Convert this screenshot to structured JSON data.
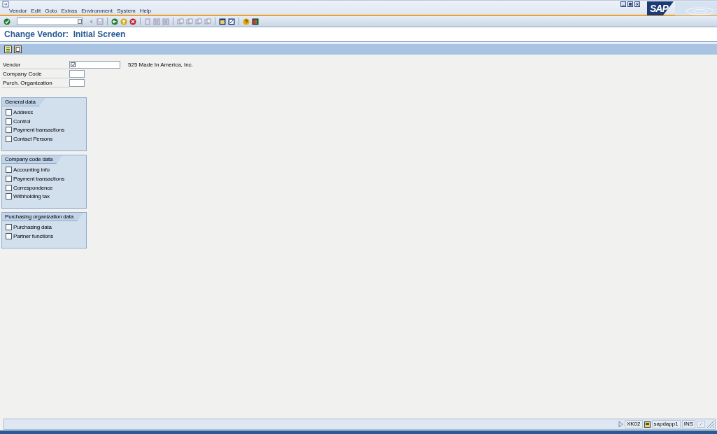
{
  "menu": [
    "Vendor",
    "Edit",
    "Goto",
    "Extras",
    "Environment",
    "System",
    "Help"
  ],
  "logo": "SAP",
  "title": "Change Vendor:  Initial Screen",
  "fields": [
    {
      "label": "Vendor",
      "description": "525 Made In America, Inc.",
      "kind": "long"
    },
    {
      "label": "Company Code",
      "kind": "short"
    },
    {
      "label": "Purch. Organization",
      "kind": "short"
    }
  ],
  "groups": [
    {
      "title": "General data",
      "items": [
        {
          "label": "Address",
          "checked": false
        },
        {
          "label": "Control",
          "checked": false
        },
        {
          "label": "Payment transactions",
          "checked": false
        },
        {
          "label": "Contact Persons",
          "checked": false
        }
      ]
    },
    {
      "title": "Company code data",
      "items": [
        {
          "label": "Accounting info",
          "checked": false
        },
        {
          "label": "Payment transactions",
          "checked": false
        },
        {
          "label": "Correspondence",
          "checked": false
        },
        {
          "label": "Withholding tax",
          "checked": false
        }
      ]
    },
    {
      "title": "Purchasing organization data",
      "items": [
        {
          "label": "Purchasing data",
          "checked": false
        },
        {
          "label": "Partner functions",
          "checked": false
        }
      ]
    }
  ],
  "status_bar": {
    "transaction": "XK02",
    "server": "sapdapp1",
    "mode": "INS"
  }
}
